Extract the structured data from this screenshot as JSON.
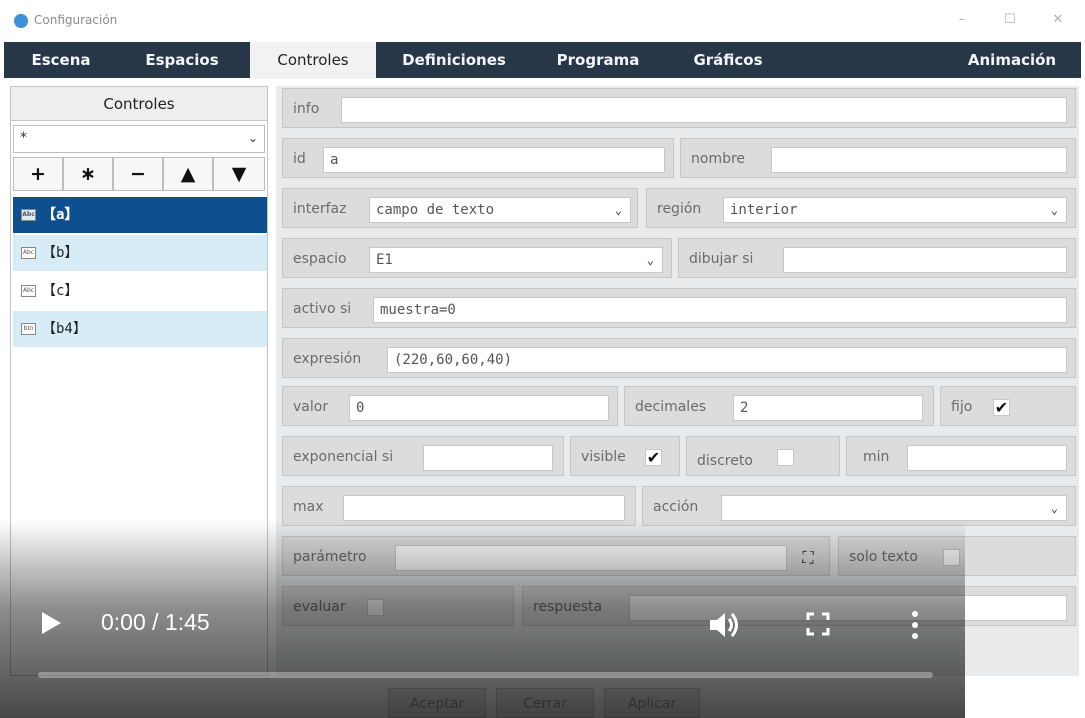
{
  "window": {
    "title": "Configuración",
    "controls": [
      "–",
      "☐",
      "✕"
    ]
  },
  "tabs": [
    {
      "label": "Escena",
      "active": false
    },
    {
      "label": "Espacios",
      "active": false
    },
    {
      "label": "Controles",
      "active": true
    },
    {
      "label": "Definiciones",
      "active": false
    },
    {
      "label": "Programa",
      "active": false
    },
    {
      "label": "Gráficos",
      "active": false
    },
    {
      "label": "Animación",
      "active": false
    }
  ],
  "left_panel": {
    "header": "Controles",
    "filter_value": "*",
    "buttons": [
      "+",
      "∗",
      "−",
      "▲",
      "▼"
    ],
    "items": [
      {
        "icon": "text-field-icon",
        "icon_text": "Abc",
        "label": "【a】",
        "selected": true
      },
      {
        "icon": "text-field-icon",
        "icon_text": "Abc",
        "label": "【b】",
        "selected": false
      },
      {
        "icon": "text-field-icon",
        "icon_text": "Abc",
        "label": "【c】",
        "selected": false
      },
      {
        "icon": "button-icon",
        "icon_text": "btn",
        "label": "【b4】",
        "selected": false
      }
    ]
  },
  "form": {
    "info_label": "info",
    "info_value": "",
    "id_label": "id",
    "id_value": "a",
    "nombre_label": "nombre",
    "nombre_value": "",
    "interfaz_label": "interfaz",
    "interfaz_value": "campo de texto",
    "region_label": "región",
    "region_value": "interior",
    "espacio_label": "espacio",
    "espacio_value": "E1",
    "dibujar_si_label": "dibujar si",
    "dibujar_si_value": "",
    "activo_si_label": "activo si",
    "activo_si_value": "muestra=0",
    "expresion_label": "expresión",
    "expresion_value": "(220,60,60,40)",
    "valor_label": "valor",
    "valor_value": "0",
    "decimales_label": "decimales",
    "decimales_value": "2",
    "fijo_label": "fijo",
    "fijo_checked": true,
    "exponencial_si_label": "exponencial si",
    "exponencial_si_value": "",
    "visible_label": "visible",
    "visible_checked": true,
    "discreto_label": "discreto",
    "discreto_checked": false,
    "min_label": "min",
    "min_value": "",
    "max_label": "max",
    "max_value": "",
    "accion_label": "acción",
    "accion_value": "",
    "parametro_label": "parámetro",
    "parametro_value": "",
    "solo_texto_label": "solo texto",
    "solo_texto_checked": false,
    "evaluar_label": "evaluar",
    "evaluar_checked": false,
    "respuesta_label": "respuesta",
    "respuesta_value": ""
  },
  "footer": {
    "aceptar": "Aceptar",
    "cerrar": "Cerrar",
    "aplicar": "Aplicar"
  },
  "video": {
    "time": "0:00 / 1:45",
    "progress_fraction": 0.0
  }
}
